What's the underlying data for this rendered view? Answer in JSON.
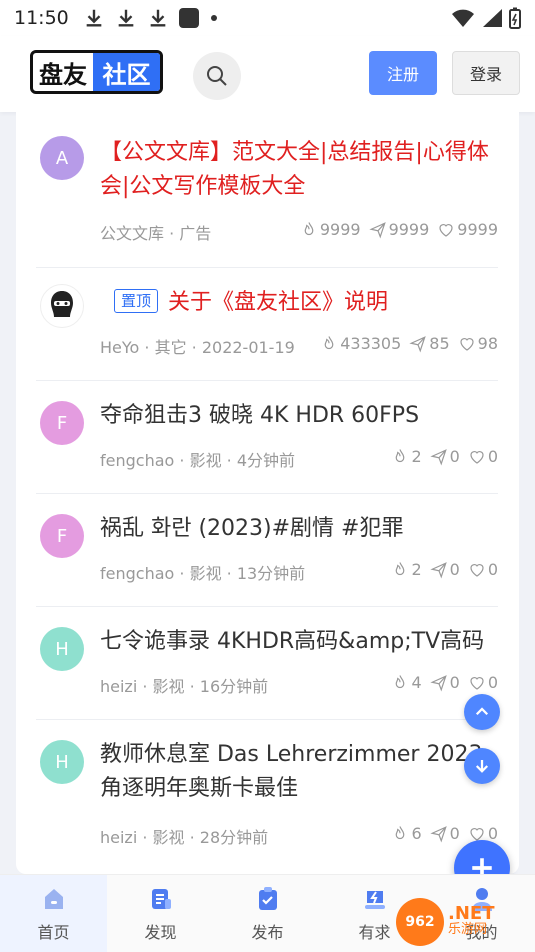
{
  "status_bar": {
    "time": "11:50"
  },
  "header": {
    "logo_part1": "盘友",
    "logo_part2": "社区",
    "register_label": "注册",
    "login_label": "登录"
  },
  "posts": [
    {
      "avatar_letter": "A",
      "avatar_color": "#b79be8",
      "title": "【公文文库】范文大全|总结报告|心得体会|公文写作模板大全",
      "meta": "公文文库 · 广告",
      "views": "9999",
      "shares": "9999",
      "likes": "9999",
      "title_color": "#e02020"
    },
    {
      "avatar_icon": "ninja-avatar",
      "pin_label": "置顶",
      "title": "关于《盘友社区》说明",
      "meta": "HeYo · 其它 · 2022-01-19",
      "views": "433305",
      "shares": "85",
      "likes": "98",
      "title_color": "#e02020"
    },
    {
      "avatar_letter": "F",
      "avatar_color": "#e49ce0",
      "title": "夺命狙击3 破晓 4K HDR 60FPS",
      "meta": "fengchao · 影视 · 4分钟前",
      "views": "2",
      "shares": "0",
      "likes": "0"
    },
    {
      "avatar_letter": "F",
      "avatar_color": "#e49ce0",
      "title": "祸乱 화란 (2023)#剧情 #犯罪",
      "meta": "fengchao · 影视 · 13分钟前",
      "views": "2",
      "shares": "0",
      "likes": "0"
    },
    {
      "avatar_letter": "H",
      "avatar_color": "#8fe0cf",
      "title": "七令诡事录 4KHDR高码&amp;TV高码",
      "meta": "heizi · 影视 · 16分钟前",
      "views": "4",
      "shares": "0",
      "likes": "0"
    },
    {
      "avatar_letter": "H",
      "avatar_color": "#8fe0cf",
      "title": "教师休息室 Das Lehrerzimmer 2023 角逐明年奥斯卡最佳",
      "meta": "heizi · 影视 · 28分钟前",
      "views": "6",
      "shares": "0",
      "likes": "0"
    }
  ],
  "bottom_nav": [
    {
      "label": "首页",
      "icon": "home-icon",
      "active": true
    },
    {
      "label": "发现",
      "icon": "discover-icon"
    },
    {
      "label": "发布",
      "icon": "publish-icon"
    },
    {
      "label": "有求",
      "icon": "request-icon"
    },
    {
      "label": "我的",
      "icon": "user-icon"
    }
  ],
  "watermark": {
    "circle": "962",
    "text": ".NET",
    "sub": "乐游网"
  },
  "colors": {
    "accent": "#2f6ff5",
    "button_blue": "#5b8cff",
    "fab": "#4f86ff",
    "red_title": "#e02020"
  }
}
